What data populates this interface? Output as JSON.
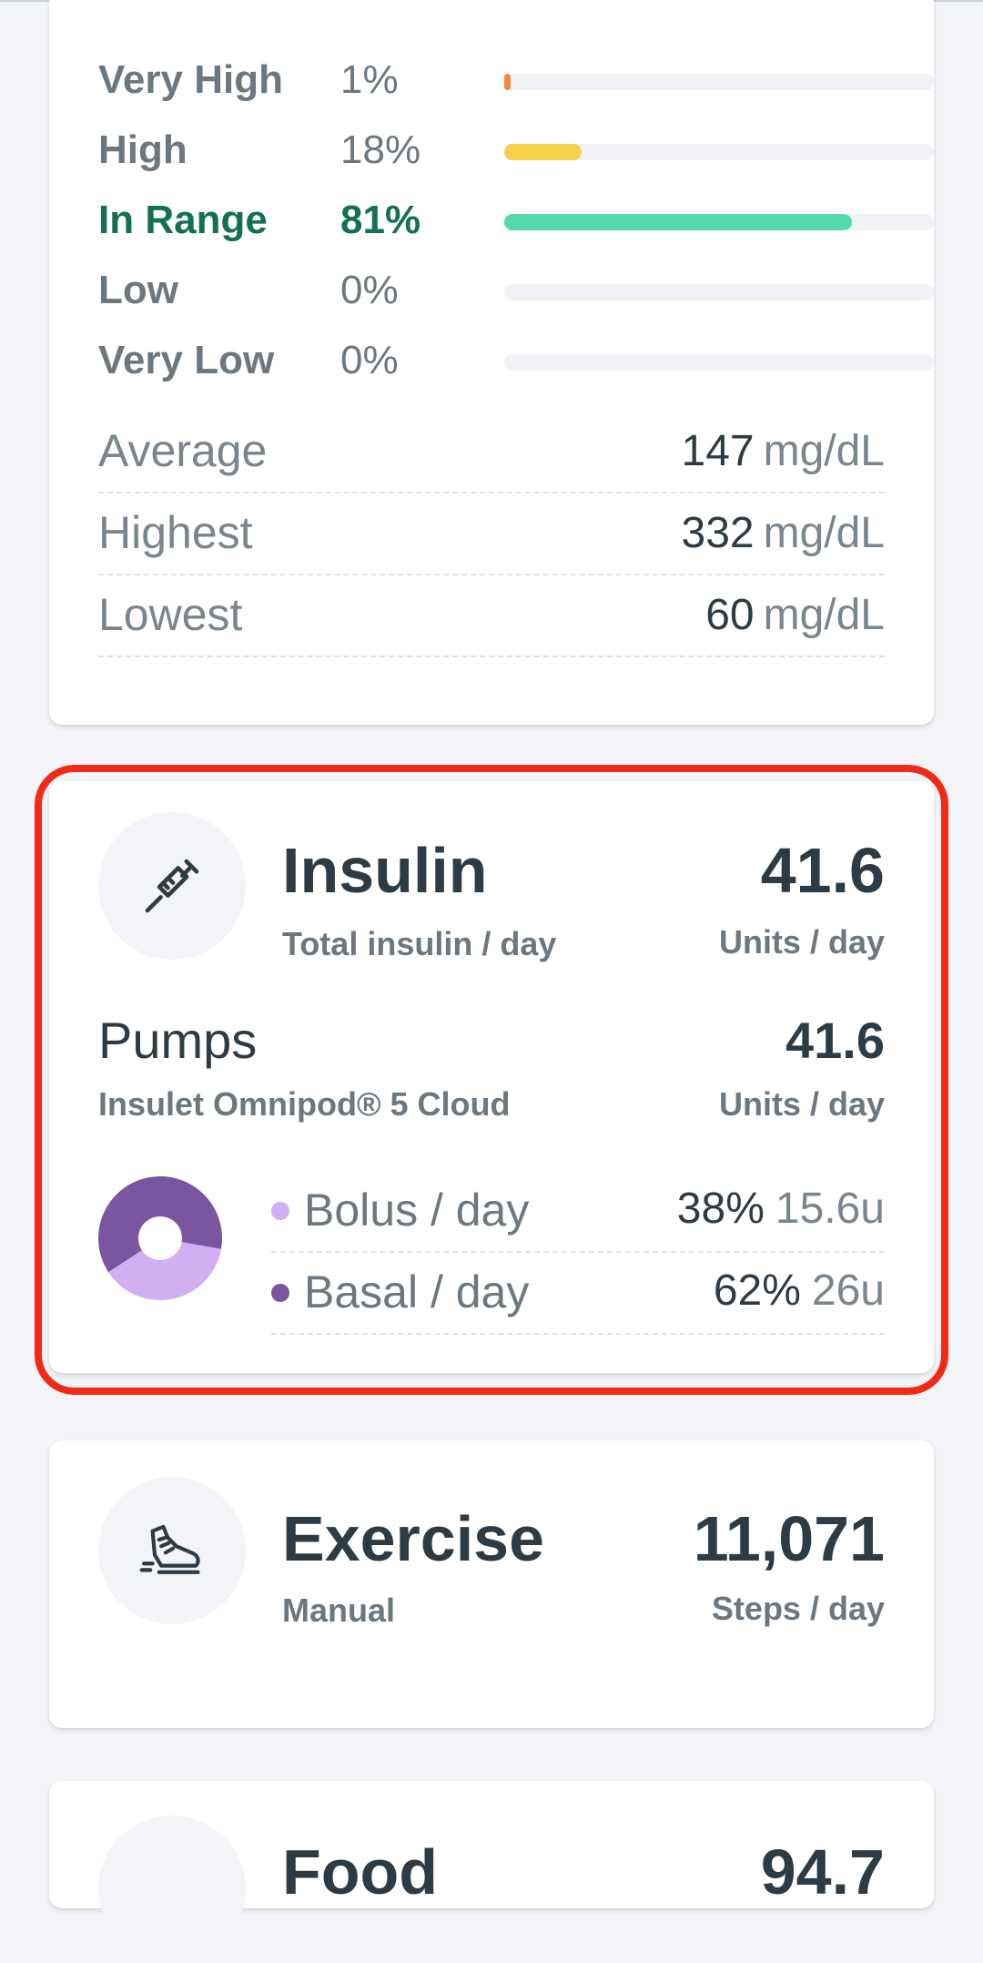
{
  "glucose": {
    "ranges": [
      {
        "label": "Very High",
        "pct": "1%",
        "value": 1,
        "color": "#f0883e"
      },
      {
        "label": "High",
        "pct": "18%",
        "value": 18,
        "color": "#f5d04a"
      },
      {
        "label": "In Range",
        "pct": "81%",
        "value": 81,
        "color": "#55d9ab",
        "active": true
      },
      {
        "label": "Low",
        "pct": "0%",
        "value": 0,
        "color": "#e25b5b"
      },
      {
        "label": "Very Low",
        "pct": "0%",
        "value": 0,
        "color": "#b83232"
      }
    ],
    "stats": [
      {
        "label": "Average",
        "value": "147",
        "unit": "mg/dL"
      },
      {
        "label": "Highest",
        "value": "332",
        "unit": "mg/dL"
      },
      {
        "label": "Lowest",
        "value": "60",
        "unit": "mg/dL"
      }
    ]
  },
  "insulin": {
    "title": "Insulin",
    "subtitle": "Total insulin / day",
    "total": "41.6",
    "total_unit": "Units / day",
    "pumps_title": "Pumps",
    "pumps_device": "Insulet Omnipod® 5 Cloud",
    "pumps_total": "41.6",
    "pumps_unit": "Units / day",
    "breakdown": [
      {
        "label": "Bolus / day",
        "pct": "38%",
        "units": "15.6u",
        "value": 38,
        "color": "#d2aef3"
      },
      {
        "label": "Basal / day",
        "pct": "62%",
        "units": "26u",
        "value": 62,
        "color": "#7a56a0"
      }
    ]
  },
  "exercise": {
    "title": "Exercise",
    "subtitle": "Manual",
    "total": "11,071",
    "total_unit": "Steps / day"
  },
  "food": {
    "title": "Food",
    "total": "94.7"
  },
  "icons": {
    "insulin": "syringe-icon",
    "exercise": "sneaker-icon"
  }
}
